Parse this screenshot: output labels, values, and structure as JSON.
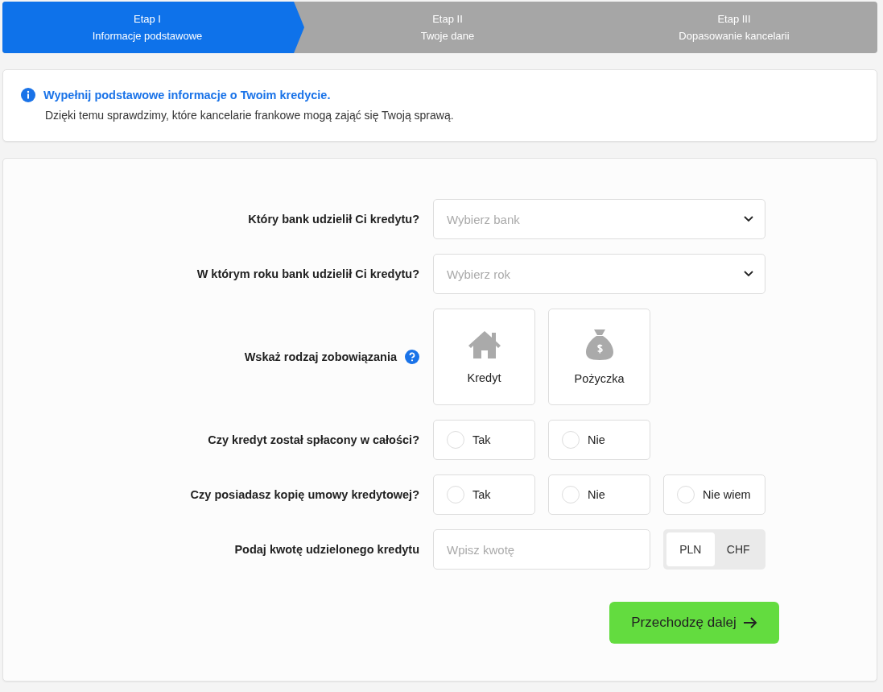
{
  "steps": [
    {
      "title": "Etap I",
      "subtitle": "Informacje podstawowe",
      "selected": true
    },
    {
      "title": "Etap II",
      "subtitle": "Twoje dane",
      "selected": false
    },
    {
      "title": "Etap III",
      "subtitle": "Dopasowanie kancelarii",
      "selected": false
    }
  ],
  "info": {
    "heading": "Wypełnij podstawowe informacje o Twoim kredycie.",
    "text": "Dzięki temu sprawdzimy, które kancelarie frankowe mogą zająć się Twoją sprawą."
  },
  "form": {
    "rows": [
      {
        "kind": "select",
        "label": "Który bank udzielił Ci kredytu?",
        "placeholder": "Wybierz bank"
      },
      {
        "kind": "select",
        "label": "W którym roku bank udzielił Ci kredytu?",
        "placeholder": "Wybierz rok"
      },
      {
        "kind": "tiles",
        "label": "Wskaż rodzaj zobowiązania",
        "help": true,
        "options": [
          {
            "label": "Kredyt",
            "kind": "house",
            "selected": false
          },
          {
            "label": "Pożyczka",
            "kind": "moneybag",
            "selected": false
          }
        ]
      },
      {
        "kind": "radio",
        "label": "Czy kredyt został spłacony w całości?",
        "options": [
          {
            "label": "Tak",
            "selected": false
          },
          {
            "label": "Nie",
            "selected": false
          }
        ]
      },
      {
        "kind": "radio",
        "label": "Czy posiadasz kopię umowy kredytowej?",
        "options": [
          {
            "label": "Tak",
            "selected": false
          },
          {
            "label": "Nie",
            "selected": false
          },
          {
            "label": "Nie wiem",
            "selected": false
          }
        ]
      },
      {
        "kind": "amount",
        "label": "Podaj kwotę udzielonego kredytu",
        "placeholder": "Wpisz kwotę",
        "currencies": [
          {
            "label": "PLN",
            "selected": true
          },
          {
            "label": "CHF",
            "selected": false
          }
        ]
      }
    ],
    "submit": "Przechodzę dalej"
  }
}
